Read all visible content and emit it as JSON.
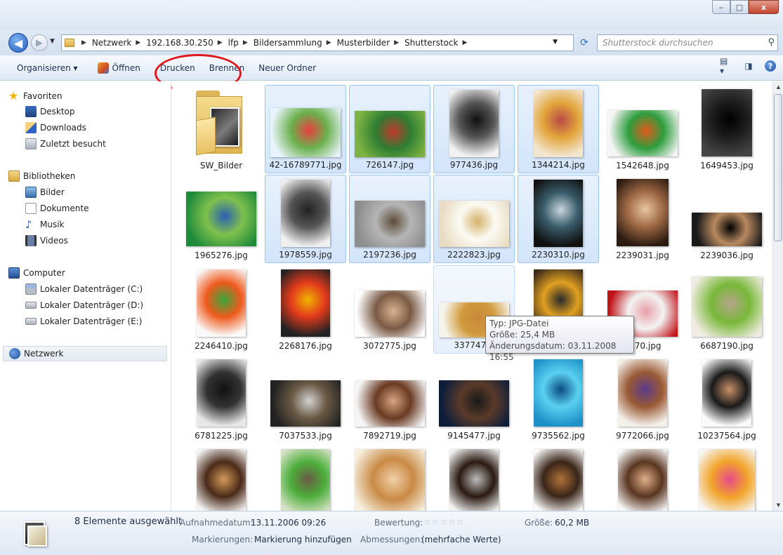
{
  "window": {
    "min": "‒",
    "max": "□",
    "close": "x"
  },
  "address": {
    "crumbs": [
      "Netzwerk",
      "192.168.30.250",
      "lfp",
      "Bildersammlung",
      "Musterbilder",
      "Shutterstock"
    ],
    "search_placeholder": "Shutterstock durchsuchen"
  },
  "toolbar": {
    "organize": "Organisieren ▾",
    "open": "Öffnen",
    "print": "Drucken",
    "burn": "Brennen",
    "new_folder": "Neuer Ordner"
  },
  "sidebar": {
    "favorites": "Favoriten",
    "desktop": "Desktop",
    "downloads": "Downloads",
    "recent": "Zuletzt besucht",
    "libraries": "Bibliotheken",
    "pictures": "Bilder",
    "documents": "Dokumente",
    "music": "Musik",
    "videos": "Videos",
    "computer": "Computer",
    "drive_c": "Lokaler Datenträger (C:)",
    "drive_d": "Lokaler Datenträger (D:)",
    "drive_e": "Lokaler Datenträger (E:)",
    "network": "Netzwerk"
  },
  "files": [
    [
      "SW_Bilder",
      "42-16789771.jpg",
      "726147.jpg",
      "977436.jpg",
      "1344214.jpg",
      "1542648.jpg",
      "1649453.jpg"
    ],
    [
      "1965276.jpg",
      "1978559.jpg",
      "2197236.jpg",
      "2222823.jpg",
      "2230310.jpg",
      "2239031.jpg",
      "2239036.jpg"
    ],
    [
      "2246410.jpg",
      "2268176.jpg",
      "3072775.jpg",
      "3377477.",
      "",
      "3470.jpg",
      "6687190.jpg"
    ],
    [
      "6781225.jpg",
      "7037533.jpg",
      "7892719.jpg",
      "9145477.jpg",
      "9735562.jpg",
      "9772066.jpg",
      "10237564.jpg"
    ],
    [
      "",
      "",
      "",
      "",
      "",
      "",
      ""
    ]
  ],
  "tooltip": {
    "type": "Typ: JPG-Datei",
    "size": "Größe: 25,4 MB",
    "date": "Änderungsdatum: 03.11.2008 16:55"
  },
  "status": {
    "selected": "8 Elemente ausgewählt",
    "date_label": "Aufnahmedatum:",
    "date_value": "13.11.2006 09:26",
    "rating_label": "Bewertung:",
    "rating_stars": "☆☆☆☆☆",
    "size_label": "Größe:",
    "size_value": "60,2 MB",
    "tags_label": "Markierungen:",
    "tags_value": "Markierung hinzufügen",
    "dims_label": "Abmessungen:",
    "dims_value": "(mehrfache Werte)"
  },
  "colors": {
    "accent": "#e0191c",
    "selection": "#d3e5fb"
  }
}
